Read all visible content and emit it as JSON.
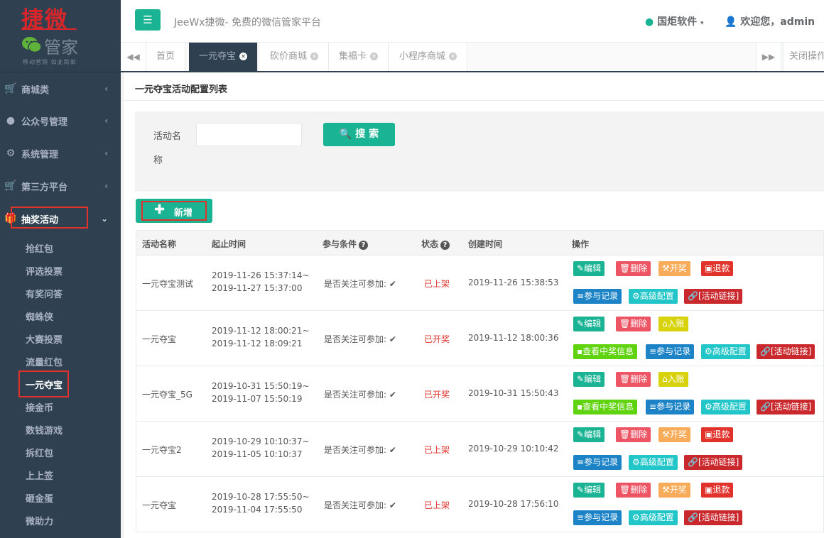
{
  "logo": {
    "title": "捷微",
    "subtitle": "管家",
    "slogan": "移动营销 如此简单"
  },
  "sidebar": {
    "menus": [
      {
        "label": "商城类",
        "icon": "cart-icon"
      },
      {
        "label": "公众号管理",
        "icon": "wechat-icon"
      },
      {
        "label": "系统管理",
        "icon": "gear-icon"
      },
      {
        "label": "第三方平台",
        "icon": "cart-icon"
      },
      {
        "label": "抽奖活动",
        "icon": "gift-icon"
      }
    ],
    "subitems": [
      "抢红包",
      "评选投票",
      "有奖问答",
      "蜘蛛侠",
      "大赛投票",
      "流量红包",
      "一元夺宝",
      "接金币",
      "数钱游戏",
      "拆红包",
      "上上签",
      "砸金蛋",
      "微助力"
    ]
  },
  "header": {
    "menu_icon": "☰",
    "app_title": "JeeWx捷微- 免费的微信管家平台",
    "brand": "国炬软件",
    "welcome": "欢迎您，admin"
  },
  "tabs": {
    "home": "首页",
    "items": [
      "一元夺宝",
      "砍价商城",
      "集福卡",
      "小程序商城"
    ],
    "close_ops": "关闭操作"
  },
  "page": {
    "title": "一元夺宝活动配置列表",
    "search": {
      "label_line1": "活动名",
      "label_line2": "称",
      "value": "",
      "button": "搜 索"
    },
    "add_button": "新增",
    "columns": [
      "活动名称",
      "起止时间",
      "参与条件",
      "状态",
      "创建时间",
      "操作"
    ],
    "rows": [
      {
        "name": "一元夺宝测试",
        "start": "2019-11-26 15:37:14~",
        "end": "2019-11-27 15:37:00",
        "cond": "是否关注可参加:",
        "status": "已上架",
        "created": "2019-11-26 15:38:53",
        "line1": [
          {
            "label": "编辑",
            "cls": "b-edit",
            "icon": "✎"
          },
          {
            "label": "删除",
            "cls": "b-del",
            "icon": "🗑"
          },
          {
            "label": "开奖",
            "cls": "b-open",
            "icon": "⚒"
          },
          {
            "label": "退款",
            "cls": "b-ref",
            "icon": "▣"
          }
        ],
        "line2": [
          {
            "label": "参与记录",
            "cls": "b-rec",
            "icon": "≡"
          },
          {
            "label": "高级配置",
            "cls": "b-cfg",
            "icon": "⚙"
          },
          {
            "label": "[活动链接]",
            "cls": "b-link",
            "icon": "🔗"
          }
        ]
      },
      {
        "name": "一元夺宝",
        "start": "2019-11-12 18:00:21~",
        "end": "2019-11-12 18:09:21",
        "cond": "是否关注可参加:",
        "status": "已开奖",
        "created": "2019-11-12 18:00:36",
        "line1": [
          {
            "label": "编辑",
            "cls": "b-edit",
            "icon": "✎"
          },
          {
            "label": "删除",
            "cls": "b-del",
            "icon": "🗑"
          },
          {
            "label": "入账",
            "cls": "b-in",
            "icon": "⌂"
          }
        ],
        "line2": [
          {
            "label": "查看中奖信息",
            "cls": "b-win",
            "icon": "▪"
          },
          {
            "label": "参与记录",
            "cls": "b-rec",
            "icon": "≡"
          },
          {
            "label": "高级配置",
            "cls": "b-cfg",
            "icon": "⚙"
          },
          {
            "label": "[活动链接]",
            "cls": "b-link",
            "icon": "🔗"
          }
        ]
      },
      {
        "name": "一元夺宝_5G",
        "start": "2019-10-31 15:50:19~",
        "end": "2019-11-07 15:50:19",
        "cond": "是否关注可参加:",
        "status": "已开奖",
        "created": "2019-10-31 15:50:43",
        "line1": [
          {
            "label": "编辑",
            "cls": "b-edit",
            "icon": "✎"
          },
          {
            "label": "删除",
            "cls": "b-del",
            "icon": "🗑"
          },
          {
            "label": "入账",
            "cls": "b-in",
            "icon": "⌂"
          }
        ],
        "line2": [
          {
            "label": "查看中奖信息",
            "cls": "b-win",
            "icon": "▪"
          },
          {
            "label": "参与记录",
            "cls": "b-rec",
            "icon": "≡"
          },
          {
            "label": "高级配置",
            "cls": "b-cfg",
            "icon": "⚙"
          },
          {
            "label": "[活动链接]",
            "cls": "b-link",
            "icon": "🔗"
          }
        ]
      },
      {
        "name": "一元夺宝2",
        "start": "2019-10-29 10:10:37~",
        "end": "2019-11-05 10:10:37",
        "cond": "是否关注可参加:",
        "status": "已上架",
        "created": "2019-10-29 10:10:42",
        "line1": [
          {
            "label": "编辑",
            "cls": "b-edit",
            "icon": "✎"
          },
          {
            "label": "删除",
            "cls": "b-del",
            "icon": "🗑"
          },
          {
            "label": "开奖",
            "cls": "b-open",
            "icon": "⚒"
          },
          {
            "label": "退款",
            "cls": "b-ref",
            "icon": "▣"
          }
        ],
        "line2": [
          {
            "label": "参与记录",
            "cls": "b-rec",
            "icon": "≡"
          },
          {
            "label": "高级配置",
            "cls": "b-cfg",
            "icon": "⚙"
          },
          {
            "label": "[活动链接]",
            "cls": "b-link",
            "icon": "🔗"
          }
        ]
      },
      {
        "name": "一元夺宝",
        "start": "2019-10-28 17:55:50~",
        "end": "2019-11-04 17:55:50",
        "cond": "是否关注可参加:",
        "status": "已上架",
        "created": "2019-10-28 17:56:10",
        "line1": [
          {
            "label": "编辑",
            "cls": "b-edit",
            "icon": "✎"
          },
          {
            "label": "删除",
            "cls": "b-del",
            "icon": "🗑"
          },
          {
            "label": "开奖",
            "cls": "b-open",
            "icon": "⚒"
          },
          {
            "label": "退款",
            "cls": "b-ref",
            "icon": "▣"
          }
        ],
        "line2": [
          {
            "label": "参与记录",
            "cls": "b-rec",
            "icon": "≡"
          },
          {
            "label": "高级配置",
            "cls": "b-cfg",
            "icon": "⚙"
          },
          {
            "label": "[活动链接]",
            "cls": "b-link",
            "icon": "🔗"
          }
        ]
      }
    ]
  }
}
